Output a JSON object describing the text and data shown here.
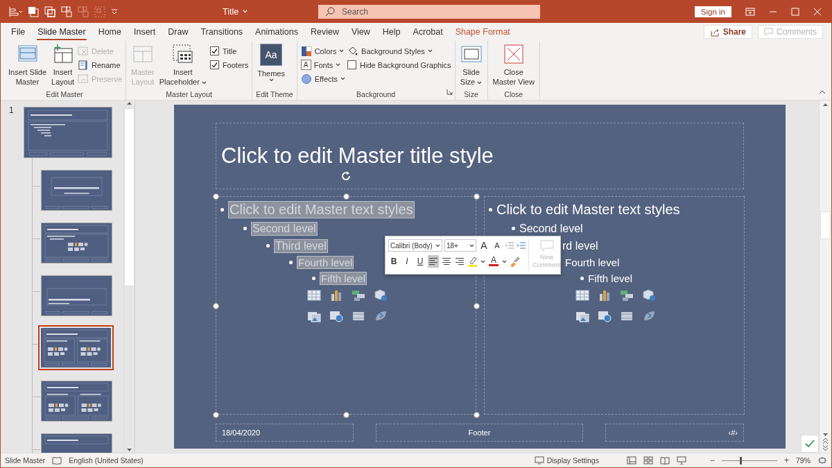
{
  "title_bar": {
    "quick_access": [
      {
        "kind": "align",
        "disabled": false
      },
      {
        "kind": "bring-forward",
        "disabled": false
      },
      {
        "kind": "send-backward",
        "disabled": false
      },
      {
        "kind": "selection",
        "disabled": false
      },
      {
        "kind": "selection",
        "disabled": true
      },
      {
        "kind": "ungroup",
        "disabled": true
      },
      {
        "kind": "customize",
        "disabled": false
      }
    ],
    "document_title": "Title",
    "search": {
      "placeholder": "Search"
    },
    "sign_in": "Sign in"
  },
  "tabs": [
    {
      "label": "File",
      "selected": false,
      "kind": "normal"
    },
    {
      "label": "Slide Master",
      "selected": true,
      "kind": "normal"
    },
    {
      "label": "Home",
      "selected": false,
      "kind": "normal"
    },
    {
      "label": "Insert",
      "selected": false,
      "kind": "normal"
    },
    {
      "label": "Draw",
      "selected": false,
      "kind": "normal"
    },
    {
      "label": "Transitions",
      "selected": false,
      "kind": "normal"
    },
    {
      "label": "Animations",
      "selected": false,
      "kind": "normal"
    },
    {
      "label": "Review",
      "selected": false,
      "kind": "normal"
    },
    {
      "label": "View",
      "selected": false,
      "kind": "normal"
    },
    {
      "label": "Help",
      "selected": false,
      "kind": "normal"
    },
    {
      "label": "Acrobat",
      "selected": false,
      "kind": "normal"
    },
    {
      "label": "Shape Format",
      "selected": false,
      "kind": "contextual"
    }
  ],
  "share": "Share",
  "comments": {
    "label": "Comments",
    "disabled": true
  },
  "ribbon": {
    "groups": [
      {
        "label": "Edit Master",
        "launcher": false,
        "items": [
          {
            "kind": "slide-master",
            "lines": [
              "Insert Slide",
              "Master"
            ],
            "disabled": false,
            "dropdown": false
          },
          {
            "kind": "insert-layout",
            "lines": [
              "Insert",
              "Layout"
            ],
            "disabled": false,
            "dropdown": false
          },
          {
            "kind": "column",
            "items": [
              {
                "kind": "delete",
                "label": "Delete",
                "disabled": true,
                "dropdown": false
              },
              {
                "kind": "rename",
                "label": "Rename",
                "disabled": false,
                "dropdown": false
              },
              {
                "kind": "preserve",
                "label": "Preserve",
                "disabled": true,
                "dropdown": false
              }
            ]
          }
        ]
      },
      {
        "label": "Master Layout",
        "launcher": false,
        "items": [
          {
            "kind": "master-layout",
            "lines": [
              "Master",
              "Layout"
            ],
            "disabled": true,
            "dropdown": false
          },
          {
            "kind": "placeholder",
            "lines": [
              "Insert",
              "Placeholder"
            ],
            "disabled": false,
            "dropdown": true
          },
          {
            "kind": "column",
            "items": [
              {
                "kind": "check",
                "label": "Title",
                "checked": true
              },
              {
                "kind": "check",
                "label": "Footers",
                "checked": true
              }
            ]
          }
        ]
      },
      {
        "label": "Edit Theme",
        "launcher": false,
        "items": [
          {
            "kind": "themes",
            "icon_text": "Aa",
            "lines": [
              "Themes"
            ],
            "disabled": false,
            "dropdown": true
          }
        ]
      },
      {
        "label": "Background",
        "launcher": true,
        "items": [
          {
            "kind": "column",
            "items": [
              {
                "kind": "colors",
                "label": "Colors",
                "disabled": false,
                "dropdown": true
              },
              {
                "kind": "fonts",
                "icon_text": "A",
                "label": "Fonts",
                "disabled": false,
                "dropdown": true
              },
              {
                "kind": "effects",
                "label": "Effects",
                "disabled": false,
                "dropdown": true
              }
            ]
          },
          {
            "kind": "column",
            "items": [
              {
                "kind": "background-styles",
                "label": "Background Styles",
                "disabled": false,
                "dropdown": true
              },
              {
                "kind": "check",
                "label": "Hide Background Graphics",
                "checked": false
              }
            ]
          }
        ]
      },
      {
        "label": "Size",
        "launcher": false,
        "items": [
          {
            "kind": "slide-size",
            "lines": [
              "Slide",
              "Size"
            ],
            "disabled": false,
            "dropdown": true
          }
        ]
      },
      {
        "label": "Close",
        "launcher": false,
        "items": [
          {
            "kind": "close-view",
            "lines": [
              "Close",
              "Master View"
            ],
            "disabled": false,
            "dropdown": false
          }
        ]
      }
    ]
  },
  "thumbnails": [
    {
      "number": "1",
      "kind": "master",
      "selected": false,
      "children": [
        {
          "kind": "title-slide",
          "selected": false
        },
        {
          "kind": "title-content",
          "selected": false
        },
        {
          "kind": "section",
          "selected": false
        },
        {
          "kind": "two-content",
          "selected": true
        },
        {
          "kind": "comparison",
          "selected": false
        },
        {
          "kind": "title-only",
          "selected": false
        }
      ]
    }
  ],
  "slide": {
    "title": "Click to edit Master title style",
    "placeholders": [
      {
        "selected": true,
        "levels": [
          {
            "text": "Click to edit Master text styles",
            "covered": false,
            "children": [
              {
                "text": "Second level",
                "covered": false,
                "children": [
                  {
                    "text": "Third level",
                    "covered": false,
                    "children": [
                      {
                        "text": "Fourth level",
                        "covered": false,
                        "children": [
                          {
                            "text": "Fifth level",
                            "covered": false
                          }
                        ]
                      }
                    ]
                  }
                ]
              }
            ]
          }
        ]
      },
      {
        "selected": false,
        "levels": [
          {
            "text": "Click to edit Master text styles",
            "covered": false,
            "children": [
              {
                "text": "Second level",
                "covered": false,
                "children": [
                  {
                    "text": "rd level",
                    "covered": true,
                    "children": [
                      {
                        "text": "Fourth level",
                        "covered": false,
                        "children": [
                          {
                            "text": "Fifth level",
                            "covered": false
                          }
                        ]
                      }
                    ]
                  }
                ]
              }
            ]
          }
        ]
      }
    ],
    "footer": {
      "date": "18/04/2020",
      "center": "Footer",
      "number": "‹#›"
    }
  },
  "mini_toolbar": {
    "font": "Calibri (Body)",
    "size": "18+",
    "grow": "A",
    "shrink": "A",
    "bold": "B",
    "italic": "I",
    "underline": "U",
    "align": [
      {
        "kind": "left",
        "selected": true
      },
      {
        "kind": "center",
        "selected": false
      },
      {
        "kind": "right",
        "selected": false
      }
    ],
    "font_color": "A",
    "new_comment": {
      "lines": [
        "New",
        "Comment"
      ],
      "disabled": true
    }
  },
  "status_bar": {
    "view_name": "Slide Master",
    "language": "English (United States)",
    "display_settings": "Display Settings",
    "views": [
      {
        "kind": "normal",
        "selected": false
      },
      {
        "kind": "sorter",
        "selected": false
      },
      {
        "kind": "reading",
        "selected": false
      },
      {
        "kind": "slideshow",
        "selected": false
      }
    ],
    "zoom": {
      "minus": "−",
      "plus": "+",
      "level": 0.34,
      "percent": "79%"
    }
  }
}
